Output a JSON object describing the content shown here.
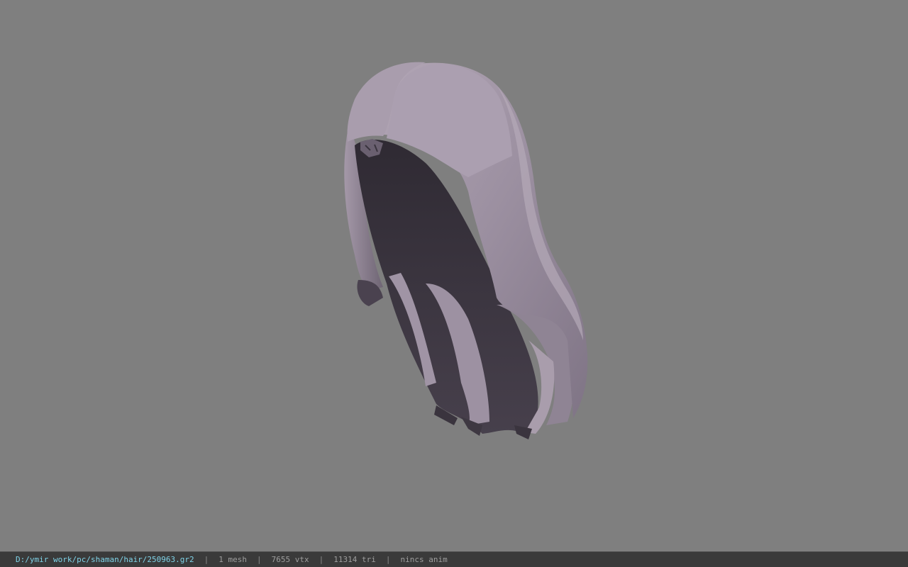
{
  "viewport": {
    "model_name": "hair-mesh",
    "background_color": "#7f7f7f",
    "hair_light_color": "#a69aa9",
    "hair_mid_color": "#8a7f8e",
    "hair_dark_color": "#3c3640"
  },
  "statusbar": {
    "file_path": "D:/ymir work/pc/shaman/hair/250963.gr2",
    "separator": "|",
    "mesh_count": "1 mesh",
    "vertex_count": "7655 vtx",
    "triangle_count": "11314 tri",
    "anim_status": "nincs anim"
  }
}
